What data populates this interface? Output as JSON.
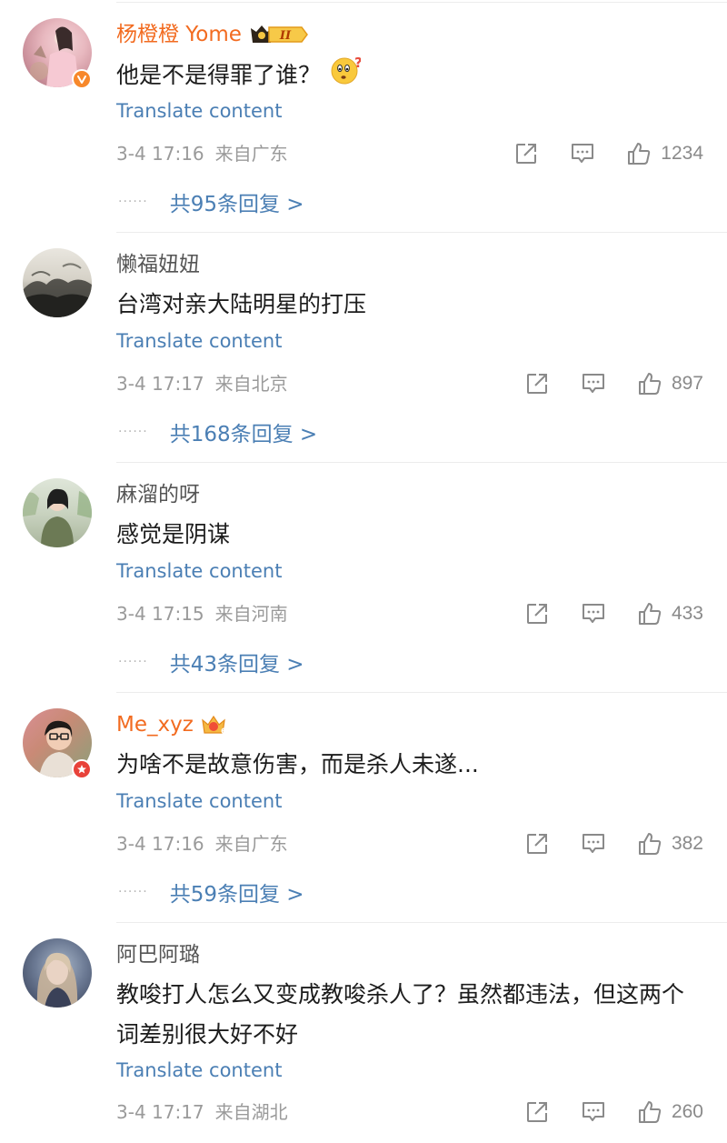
{
  "comments": [
    {
      "username": "杨橙橙 Yome",
      "vip": true,
      "badge": "v",
      "content": "他是不是得罪了谁？",
      "emoji": "thinking-face-emoji",
      "translate": "Translate content",
      "time": "3-4 17:16",
      "location": "来自广东",
      "likes": "1234",
      "replies": "共95条回复 >"
    },
    {
      "username": "懒福妞妞",
      "vip": false,
      "badge": "",
      "content": "台湾对亲大陆明星的打压",
      "translate": "Translate content",
      "time": "3-4 17:17",
      "location": "来自北京",
      "likes": "897",
      "replies": "共168条回复 >"
    },
    {
      "username": "麻溜的呀",
      "vip": false,
      "badge": "",
      "content": "感觉是阴谋",
      "translate": "Translate content",
      "time": "3-4 17:15",
      "location": "来自河南",
      "likes": "433",
      "replies": "共43条回复 >"
    },
    {
      "username": "Me_xyz",
      "vip": true,
      "badge": "red",
      "content": "为啥不是故意伤害，而是杀人未遂...",
      "translate": "Translate content",
      "time": "3-4 17:16",
      "location": "来自广东",
      "likes": "382",
      "replies": "共59条回复 >"
    },
    {
      "username": "阿巴阿璐",
      "vip": false,
      "badge": "",
      "content": "教唆打人怎么又变成教唆杀人了？虽然都违法，但这两个词差别很大好不好",
      "translate": "Translate content",
      "time": "3-4 17:17",
      "location": "来自湖北",
      "likes": "260"
    }
  ],
  "colors": {
    "link": "#4b7fb4",
    "vip_name": "#f26b20",
    "meta": "#9a9a9a",
    "text": "#1d1d1d"
  },
  "icons": {
    "share": "share-icon",
    "comment": "comment-icon",
    "like": "thumbs-up-icon",
    "vip_badge": "vip-level-icon",
    "crown": "crown-icon",
    "verified": "verified-v-icon"
  },
  "vip_tags": {
    "level": "II",
    "crown_level": "6"
  }
}
